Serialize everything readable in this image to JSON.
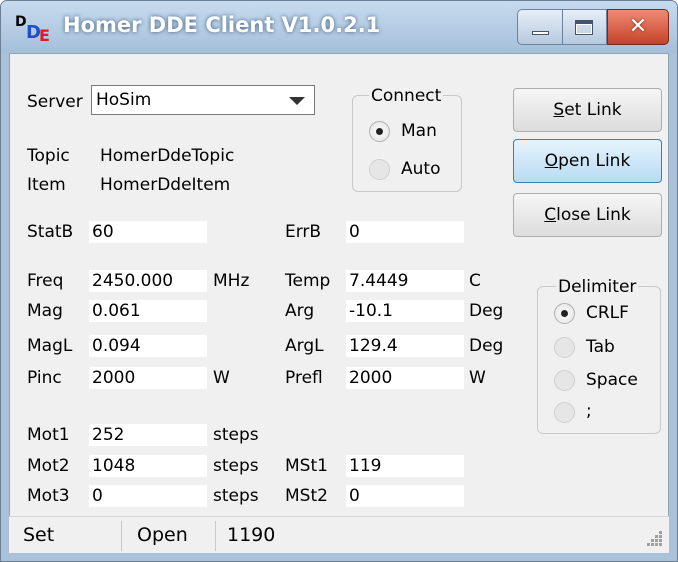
{
  "window": {
    "title": "Homer DDE Client V1.0.2.1",
    "icon_letters": [
      "D",
      "D",
      "E"
    ],
    "close_glyph": "✕"
  },
  "server": {
    "label": "Server",
    "value": "HoSim"
  },
  "topic": {
    "label": "Topic",
    "value": "HomerDdeTopic"
  },
  "item": {
    "label": "Item",
    "value": "HomerDdeItem"
  },
  "connect": {
    "title": "Connect",
    "options": [
      {
        "label": "Man",
        "selected": true
      },
      {
        "label": "Auto",
        "selected": false
      }
    ]
  },
  "buttons": {
    "set_link": {
      "accel": "S",
      "rest": "et Link"
    },
    "open_link": {
      "accel": "O",
      "rest": "pen Link"
    },
    "close_link": {
      "accel": "C",
      "rest": "lose Link"
    }
  },
  "fields": {
    "statb": {
      "label": "StatB",
      "value": "60"
    },
    "errb": {
      "label": "ErrB",
      "value": "0"
    },
    "freq": {
      "label": "Freq",
      "value": "2450.000",
      "unit": "MHz"
    },
    "temp": {
      "label": "Temp",
      "value": "7.4449",
      "unit": "C"
    },
    "mag": {
      "label": "Mag",
      "value": "0.061"
    },
    "arg": {
      "label": "Arg",
      "value": "-10.1",
      "unit": "Deg"
    },
    "magl": {
      "label": "MagL",
      "value": "0.094"
    },
    "argl": {
      "label": "ArgL",
      "value": "129.4",
      "unit": "Deg"
    },
    "pinc": {
      "label": "Pinc",
      "value": "2000",
      "unit": "W"
    },
    "prefl": {
      "label": "Prefl",
      "value": "2000",
      "unit": "W"
    },
    "mot1": {
      "label": "Mot1",
      "value": "252",
      "unit": "steps"
    },
    "mot2": {
      "label": "Mot2",
      "value": "1048",
      "unit": "steps"
    },
    "mot3": {
      "label": "Mot3",
      "value": "0",
      "unit": "steps"
    },
    "mst1": {
      "label": "MSt1",
      "value": "119"
    },
    "mst2": {
      "label": "MSt2",
      "value": "0"
    }
  },
  "delimiter": {
    "title": "Delimiter",
    "options": [
      {
        "label": "CRLF",
        "selected": true
      },
      {
        "label": "Tab",
        "selected": false
      },
      {
        "label": "Space",
        "selected": false
      },
      {
        "label": ";",
        "selected": false
      }
    ]
  },
  "statusbar": {
    "panels": [
      "Set",
      "Open",
      "1190"
    ]
  },
  "colors": {
    "title_text": "#ffffff",
    "close_button": "#c7412a",
    "hot_button": "#b8dbf3"
  }
}
